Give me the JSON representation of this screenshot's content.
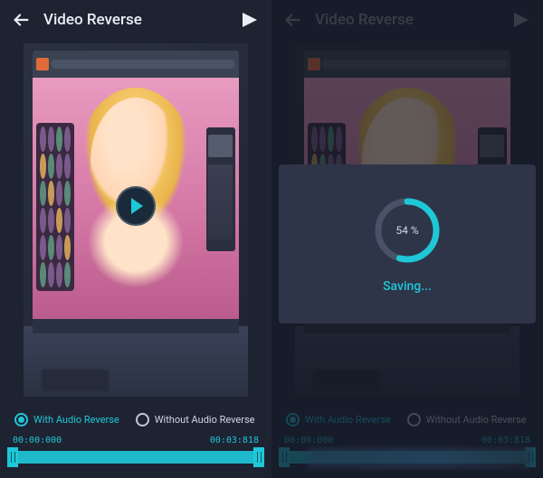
{
  "header": {
    "title": "Video Reverse"
  },
  "options": {
    "with_audio": "With Audio Reverse",
    "without_audio": "Without Audio  Reverse"
  },
  "time": {
    "start": "00:00:000",
    "end": "00:03:818"
  },
  "saving": {
    "label": "Saving...",
    "percent": "54 %",
    "value": 54
  },
  "colors": {
    "accent": "#1ec8d8",
    "bg": "#1e2332"
  }
}
